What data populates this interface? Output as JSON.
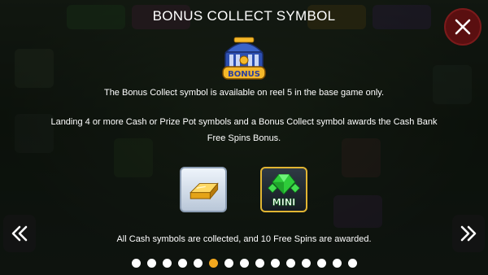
{
  "header": {
    "title": "BONUS COLLECT SYMBOL"
  },
  "symbol": {
    "badge_text": "BONUS"
  },
  "paragraphs": {
    "p1": "The Bonus Collect symbol is available on reel 5 in the base game only.",
    "p2": "Landing 4 or more Cash or Prize Pot symbols and a Bonus Collect symbol awards the Cash Bank Free Spins Bonus.",
    "p3": "All Cash symbols are collected, and 10 Free Spins are awarded."
  },
  "icons": {
    "gold_bar": "gold-bar-icon",
    "mini_gem": {
      "name": "mini-gem-icon",
      "label": "MINI"
    }
  },
  "pagination": {
    "total": 15,
    "active_index": 5
  },
  "colors": {
    "accent": "#f4a81e",
    "close_bg": "#5a0f10",
    "gem_green": "#2ecc3a",
    "gold": "#f5b82a"
  }
}
